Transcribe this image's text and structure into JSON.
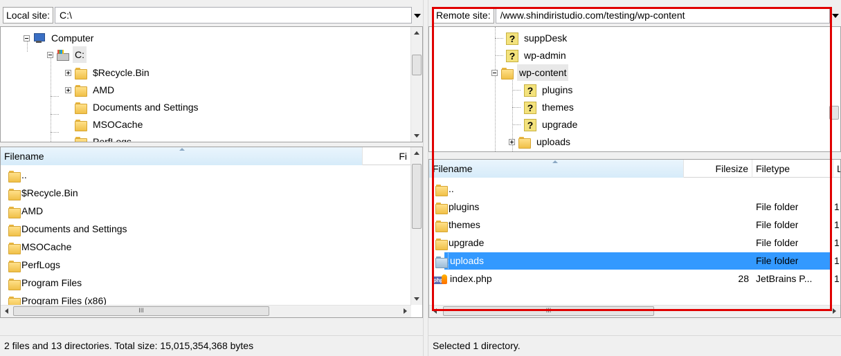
{
  "local": {
    "site_label": "Local site:",
    "path": "C:\\",
    "tree": [
      {
        "label": "Computer",
        "icon": "computer-icon"
      },
      {
        "label": "C:",
        "icon": "drive-icon"
      },
      {
        "label": "$Recycle.Bin",
        "icon": "folder-icon"
      },
      {
        "label": "AMD",
        "icon": "folder-icon"
      },
      {
        "label": "Documents and Settings",
        "icon": "folder-icon"
      },
      {
        "label": "MSOCache",
        "icon": "folder-icon"
      },
      {
        "label": "PerfLogs",
        "icon": "folder-icon"
      }
    ],
    "columns": {
      "filename": "Filename",
      "filesize": "Fi"
    },
    "files": [
      {
        "name": ".."
      },
      {
        "name": "$Recycle.Bin"
      },
      {
        "name": "AMD"
      },
      {
        "name": "Documents and Settings"
      },
      {
        "name": "MSOCache"
      },
      {
        "name": "PerfLogs"
      },
      {
        "name": "Program Files"
      },
      {
        "name": "Program Files (x86)"
      }
    ],
    "status": "2 files and 13 directories. Total size: 15,015,354,368 bytes"
  },
  "remote": {
    "site_label": "Remote site:",
    "path": "/www.shindiristudio.com/testing/wp-content",
    "tree": [
      {
        "label": "suppDesk",
        "icon": "unknown-folder-icon"
      },
      {
        "label": "wp-admin",
        "icon": "unknown-folder-icon"
      },
      {
        "label": "wp-content",
        "icon": "folder-icon"
      },
      {
        "label": "plugins",
        "icon": "unknown-folder-icon"
      },
      {
        "label": "themes",
        "icon": "unknown-folder-icon"
      },
      {
        "label": "upgrade",
        "icon": "unknown-folder-icon"
      },
      {
        "label": "uploads",
        "icon": "folder-icon"
      }
    ],
    "columns": {
      "filename": "Filename",
      "filesize": "Filesize",
      "filetype": "Filetype",
      "lastmod": "L"
    },
    "files": [
      {
        "name": "..",
        "size": "",
        "type": "",
        "lastmod": ""
      },
      {
        "name": "plugins",
        "size": "",
        "type": "File folder",
        "lastmod": "1"
      },
      {
        "name": "themes",
        "size": "",
        "type": "File folder",
        "lastmod": "1"
      },
      {
        "name": "upgrade",
        "size": "",
        "type": "File folder",
        "lastmod": "1"
      },
      {
        "name": "uploads",
        "size": "",
        "type": "File folder",
        "lastmod": "1"
      },
      {
        "name": "index.php",
        "size": "28",
        "type": "JetBrains P...",
        "lastmod": "1"
      }
    ],
    "status": "Selected 1 directory."
  },
  "scroll_thumb_grip": "III",
  "colors": {
    "selection": "#3399ff",
    "highlight_box": "#e00000",
    "folder": "#f0c048"
  }
}
